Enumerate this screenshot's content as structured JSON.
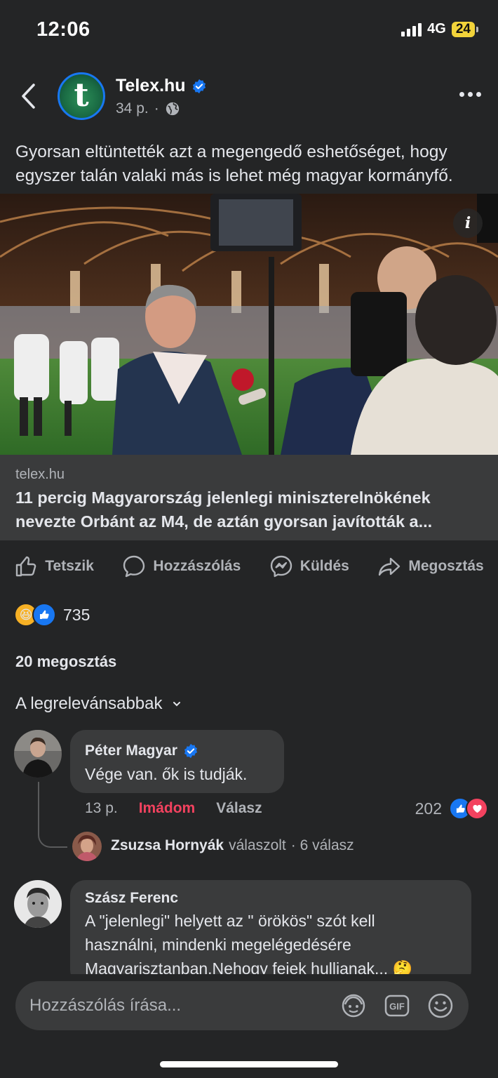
{
  "status_bar": {
    "time": "12:06",
    "network": "4G",
    "battery": "24"
  },
  "header": {
    "page_name": "Telex.hu",
    "avatar_letter": "t",
    "time_ago": "34 p.",
    "separator": "·"
  },
  "post": {
    "text": "Gyorsan eltüntették azt a megengedő eshetőséget, hogy egyszer talán valaki más is lehet még magyar kormányfő.",
    "info_badge": "i",
    "link_domain": "telex.hu",
    "link_title": "11 percig Magyarország jelenlegi miniszterelnökének nevezte Orbánt az M4, de aztán gyorsan javították a..."
  },
  "actions": {
    "like": "Tetszik",
    "comment": "Hozzászólás",
    "send": "Küldés",
    "share": "Megosztás"
  },
  "stats": {
    "reaction_count": "735",
    "shares": "20 megosztás",
    "sort_label": "A legrelevánsabbak"
  },
  "comments": [
    {
      "name": "Péter Magyar",
      "verified": true,
      "text": "Vége van. ők is tudják.",
      "time": "13 p.",
      "reaction_label": "Imádom",
      "reply_label": "Válasz",
      "reaction_count": "202",
      "reply_preview": {
        "name": "Zsuzsa Hornyák",
        "action": "válaszolt",
        "count": "· 6 válasz"
      }
    },
    {
      "name": "Szász Ferenc",
      "text_lines": [
        "A \"jelenlegi\" helyett az \" örökös\" szót kell",
        "használni, mindenki megelégedésére",
        "Magyarisztanban.Nehogy fejek hullianak..."
      ],
      "emoji": "🤔"
    }
  ],
  "composer": {
    "placeholder": "Hozzászólás írása..."
  },
  "colors": {
    "background": "#242526",
    "bubble": "#3a3b3c",
    "accent": "#1877f2",
    "love": "#f3425f"
  }
}
